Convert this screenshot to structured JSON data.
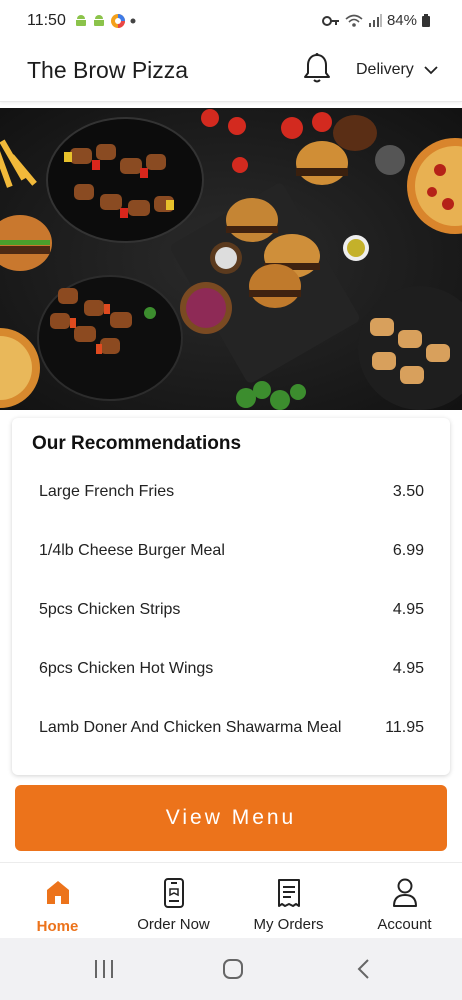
{
  "status_bar": {
    "time": "11:50",
    "battery": "84%"
  },
  "header": {
    "title": "The Brow Pizza",
    "delivery_label": "Delivery"
  },
  "recommendations": {
    "title": "Our Recommendations",
    "items": [
      {
        "name": "Large French Fries",
        "price": "3.50"
      },
      {
        "name": "1/4lb Cheese Burger Meal",
        "price": "6.99"
      },
      {
        "name": "5pcs Chicken Strips",
        "price": "4.95"
      },
      {
        "name": "6pcs Chicken Hot Wings",
        "price": "4.95"
      },
      {
        "name": "Lamb Doner And Chicken Shawarma Meal",
        "price": "11.95"
      }
    ]
  },
  "view_menu_label": "View Menu",
  "bottom_nav": {
    "items": [
      {
        "label": "Home",
        "icon": "home-icon",
        "active": true
      },
      {
        "label": "Order Now",
        "icon": "phone-order-icon",
        "active": false
      },
      {
        "label": "My Orders",
        "icon": "receipt-icon",
        "active": false
      },
      {
        "label": "Account",
        "icon": "user-icon",
        "active": false
      }
    ]
  },
  "colors": {
    "accent": "#ec731b",
    "text": "#1a1a1a"
  }
}
